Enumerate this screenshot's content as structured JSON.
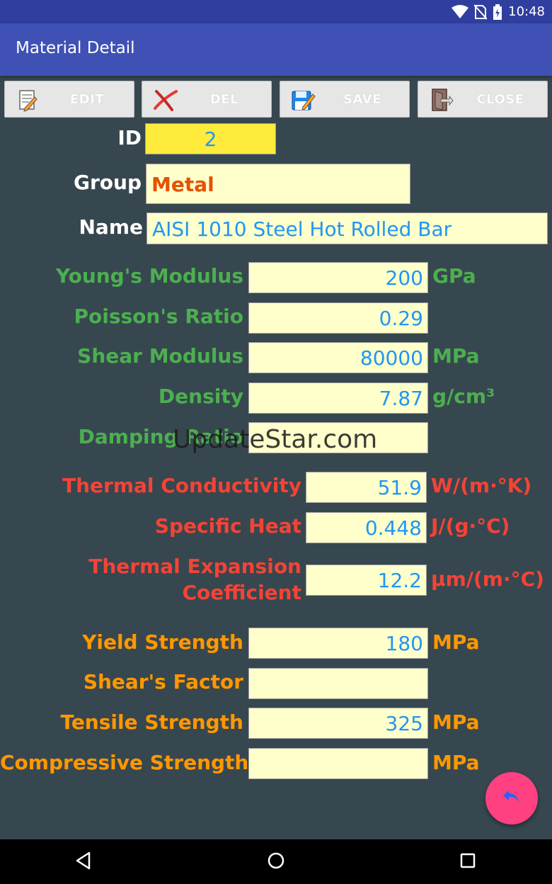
{
  "status": {
    "time": "10:48",
    "icons": [
      "wifi-icon",
      "no-sim-icon",
      "battery-icon"
    ]
  },
  "appbar": {
    "title": "Material Detail",
    "color": "#3f51b5"
  },
  "toolbar": {
    "edit": {
      "label": "EDIT",
      "icon": "edit-icon"
    },
    "del": {
      "label": "DEL",
      "icon": "delete-x-icon"
    },
    "save": {
      "label": "SAVE",
      "icon": "save-icon"
    },
    "close": {
      "label": "CLOSE",
      "icon": "exit-door-icon"
    }
  },
  "header_fields": {
    "id": {
      "label": "ID",
      "value": "2"
    },
    "group": {
      "label": "Group",
      "value": "Metal"
    },
    "name": {
      "label": "Name",
      "value": "AISI 1010 Steel Hot Rolled Bar"
    }
  },
  "mechanical": [
    {
      "label": "Young's Modulus",
      "value": "200",
      "unit": "GPa"
    },
    {
      "label": "Poisson's Ratio",
      "value": "0.29",
      "unit": ""
    },
    {
      "label": "Shear Modulus",
      "value": "80000",
      "unit": "MPa"
    },
    {
      "label": "Density",
      "value": "7.87",
      "unit": "g/cm³"
    },
    {
      "label": "Damping Ratio",
      "value": "",
      "unit": ""
    }
  ],
  "thermal": [
    {
      "label": "Thermal Conductivity",
      "value": "51.9",
      "unit": "W/(m·°K)"
    },
    {
      "label": "Specific Heat",
      "value": "0.448",
      "unit": "J/(g·°C)"
    },
    {
      "label_line1": "Thermal Expansion",
      "label_line2": "Coefficient",
      "value": "12.2",
      "unit": "μm/(m·°C)"
    }
  ],
  "strength": [
    {
      "label": "Yield Strength",
      "value": "180",
      "unit": "MPa"
    },
    {
      "label": "Shear's Factor",
      "value": "",
      "unit": ""
    },
    {
      "label": "Tensile Strength",
      "value": "325",
      "unit": "MPa"
    },
    {
      "label": "Compressive Strength",
      "value": "",
      "unit": "MPa"
    }
  ],
  "watermark": "UpdateStar.com",
  "colors": {
    "background": "#37474f",
    "green_labels": "#4caf50",
    "red_labels": "#f44336",
    "orange_labels": "#ff9800",
    "field_bg": "#ffffcc",
    "value_text": "#2196f3",
    "group_text": "#e65100",
    "fab": "#ff4081"
  },
  "fab": {
    "icon": "reply-arrow-icon"
  },
  "navbar": {
    "icons": [
      "back-triangle-icon",
      "home-circle-icon",
      "recents-square-icon"
    ]
  }
}
